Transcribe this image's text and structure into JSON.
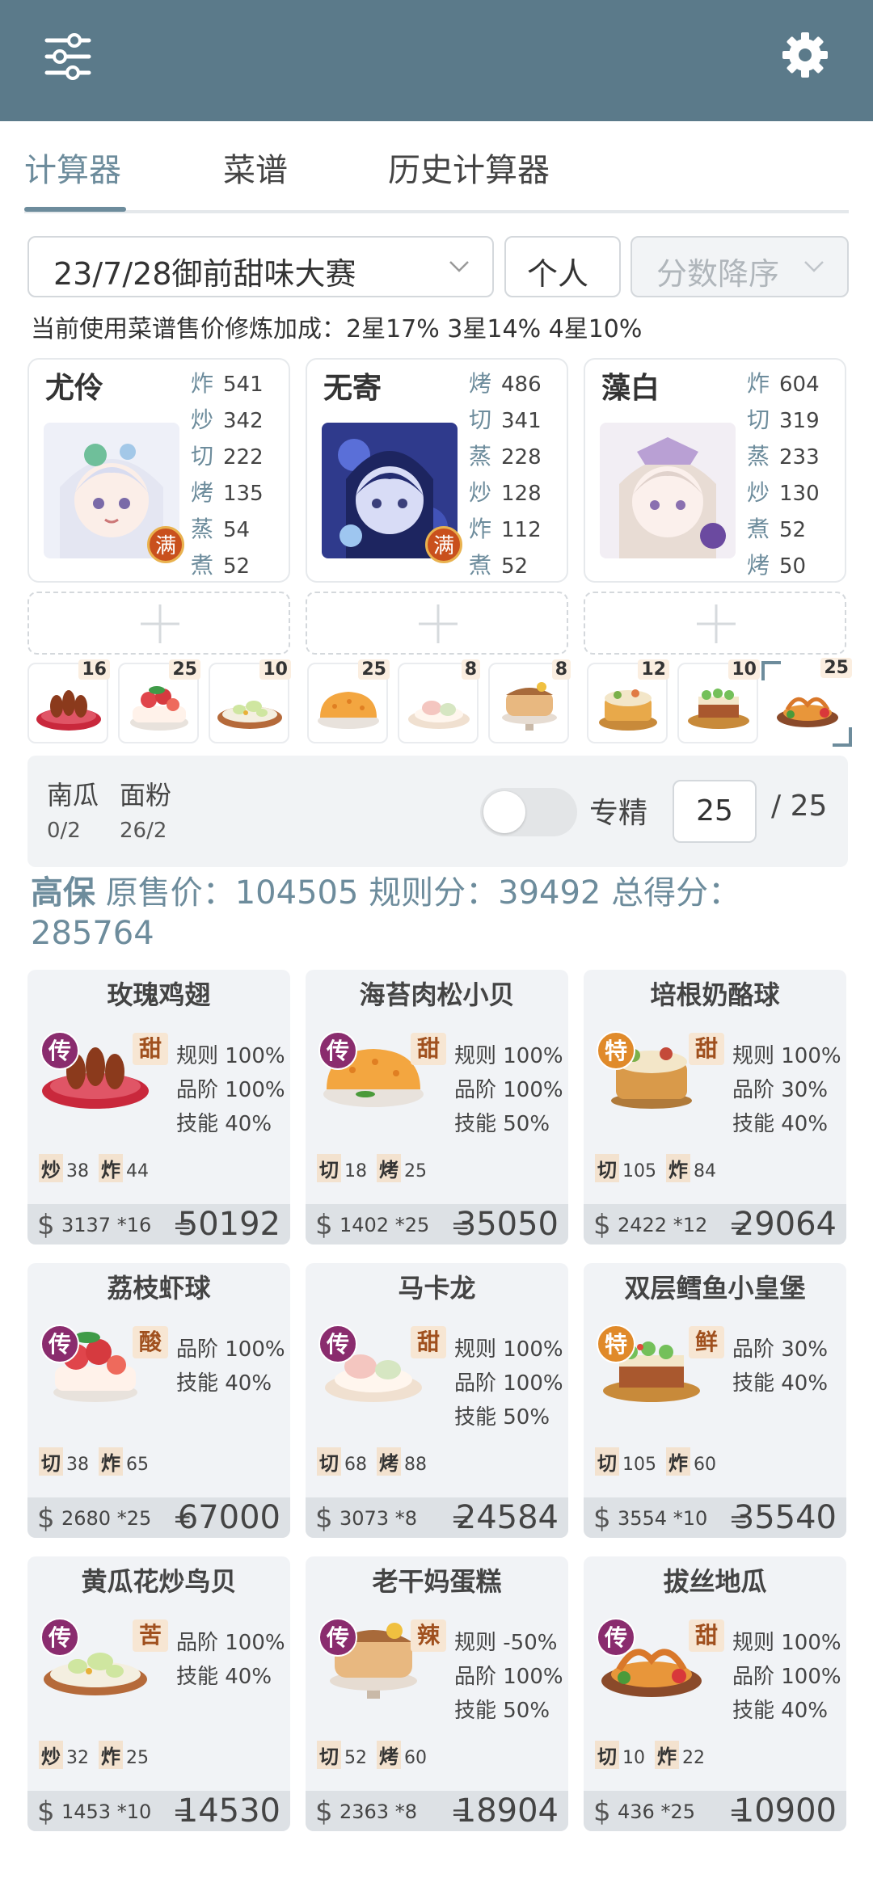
{
  "tabs": [
    "计算器",
    "菜谱",
    "历史计算器"
  ],
  "controls": {
    "event_select": "23/7/28御前甜味大赛",
    "mode_select": "个人",
    "sort_select": "分数降序"
  },
  "bonus_text": "当前使用菜谱售价修炼加成：2星17% 3星14% 4星10%",
  "chefs": [
    {
      "name": "尤伶",
      "badge": "满",
      "skills": [
        [
          "炸",
          "541"
        ],
        [
          "炒",
          "342"
        ],
        [
          "切",
          "222"
        ],
        [
          "烤",
          "135"
        ],
        [
          "蒸",
          "54"
        ],
        [
          "煮",
          "52"
        ]
      ]
    },
    {
      "name": "无寄",
      "badge": "满",
      "skills": [
        [
          "烤",
          "486"
        ],
        [
          "切",
          "341"
        ],
        [
          "蒸",
          "228"
        ],
        [
          "炒",
          "128"
        ],
        [
          "炸",
          "112"
        ],
        [
          "煮",
          "52"
        ]
      ]
    },
    {
      "name": "藻白",
      "badge": "",
      "skills": [
        [
          "炸",
          "604"
        ],
        [
          "切",
          "319"
        ],
        [
          "蒸",
          "233"
        ],
        [
          "炒",
          "130"
        ],
        [
          "煮",
          "52"
        ],
        [
          "烤",
          "50"
        ]
      ]
    }
  ],
  "dish_counts": [
    "16",
    "25",
    "10",
    "25",
    "8",
    "8",
    "12",
    "10",
    "25"
  ],
  "ingredients": [
    {
      "name": "南瓜",
      "count": "0/2"
    },
    {
      "name": "面粉",
      "count": "26/2"
    }
  ],
  "specialize": {
    "label": "专精",
    "value": "25",
    "max": "/ 25"
  },
  "summary": {
    "level": "高保",
    "text": "原售价：104505 规则分：39492 总得分：285764"
  },
  "colors": {
    "header": "#5b7a8a",
    "accent": "#6d8c9c",
    "legend_rank": "#8a2c6e",
    "special_rank": "#e08a2a"
  },
  "cards": [
    {
      "title": "玫瑰鸡翅",
      "rank": "传",
      "flavor": "甜",
      "stats": [
        "规则 100%",
        "品阶 100%",
        "技能 40%"
      ],
      "req": [
        [
          "炒",
          "38"
        ],
        [
          "炸",
          "44"
        ]
      ],
      "price": "3137 *16",
      "eq": "=",
      "total": "50192"
    },
    {
      "title": "海苔肉松小贝",
      "rank": "传",
      "flavor": "甜",
      "stats": [
        "规则 100%",
        "品阶 100%",
        "技能 50%"
      ],
      "req": [
        [
          "切",
          "18"
        ],
        [
          "烤",
          "25"
        ]
      ],
      "price": "1402 *25",
      "eq": "=",
      "total": "35050"
    },
    {
      "title": "培根奶酪球",
      "rank": "特",
      "flavor": "甜",
      "stats": [
        "规则 100%",
        "品阶 30%",
        "技能 40%"
      ],
      "req": [
        [
          "切",
          "105"
        ],
        [
          "炸",
          "84"
        ]
      ],
      "price": "2422 *12",
      "eq": "=",
      "total": "29064"
    },
    {
      "title": "荔枝虾球",
      "rank": "传",
      "flavor": "酸",
      "stats": [
        "品阶 100%",
        "技能 40%"
      ],
      "req": [
        [
          "切",
          "38"
        ],
        [
          "炸",
          "65"
        ]
      ],
      "price": "2680 *25",
      "eq": "=",
      "total": "67000"
    },
    {
      "title": "马卡龙",
      "rank": "传",
      "flavor": "甜",
      "stats": [
        "规则 100%",
        "品阶 100%",
        "技能 50%"
      ],
      "req": [
        [
          "切",
          "68"
        ],
        [
          "烤",
          "88"
        ]
      ],
      "price": "3073 *8",
      "eq": "=",
      "total": "24584"
    },
    {
      "title": "双层鳕鱼小皇堡",
      "rank": "特",
      "flavor": "鲜",
      "stats": [
        "品阶 30%",
        "技能 40%"
      ],
      "req": [
        [
          "切",
          "105"
        ],
        [
          "炸",
          "60"
        ]
      ],
      "price": "3554 *10",
      "eq": "=",
      "total": "35540"
    },
    {
      "title": "黄瓜花炒鸟贝",
      "rank": "传",
      "flavor": "苦",
      "stats": [
        "品阶 100%",
        "技能 40%"
      ],
      "req": [
        [
          "炒",
          "32"
        ],
        [
          "炸",
          "25"
        ]
      ],
      "price": "1453 *10",
      "eq": "=",
      "total": "14530"
    },
    {
      "title": "老干妈蛋糕",
      "rank": "传",
      "flavor": "辣",
      "stats": [
        "规则 -50%",
        "品阶 100%",
        "技能 50%"
      ],
      "req": [
        [
          "切",
          "52"
        ],
        [
          "烤",
          "60"
        ]
      ],
      "price": "2363 *8",
      "eq": "=",
      "total": "18904"
    },
    {
      "title": "拔丝地瓜",
      "rank": "传",
      "flavor": "甜",
      "stats": [
        "规则 100%",
        "品阶 100%",
        "技能 40%"
      ],
      "req": [
        [
          "切",
          "10"
        ],
        [
          "炸",
          "22"
        ]
      ],
      "price": "436 *25",
      "eq": "=",
      "total": "10900"
    }
  ]
}
